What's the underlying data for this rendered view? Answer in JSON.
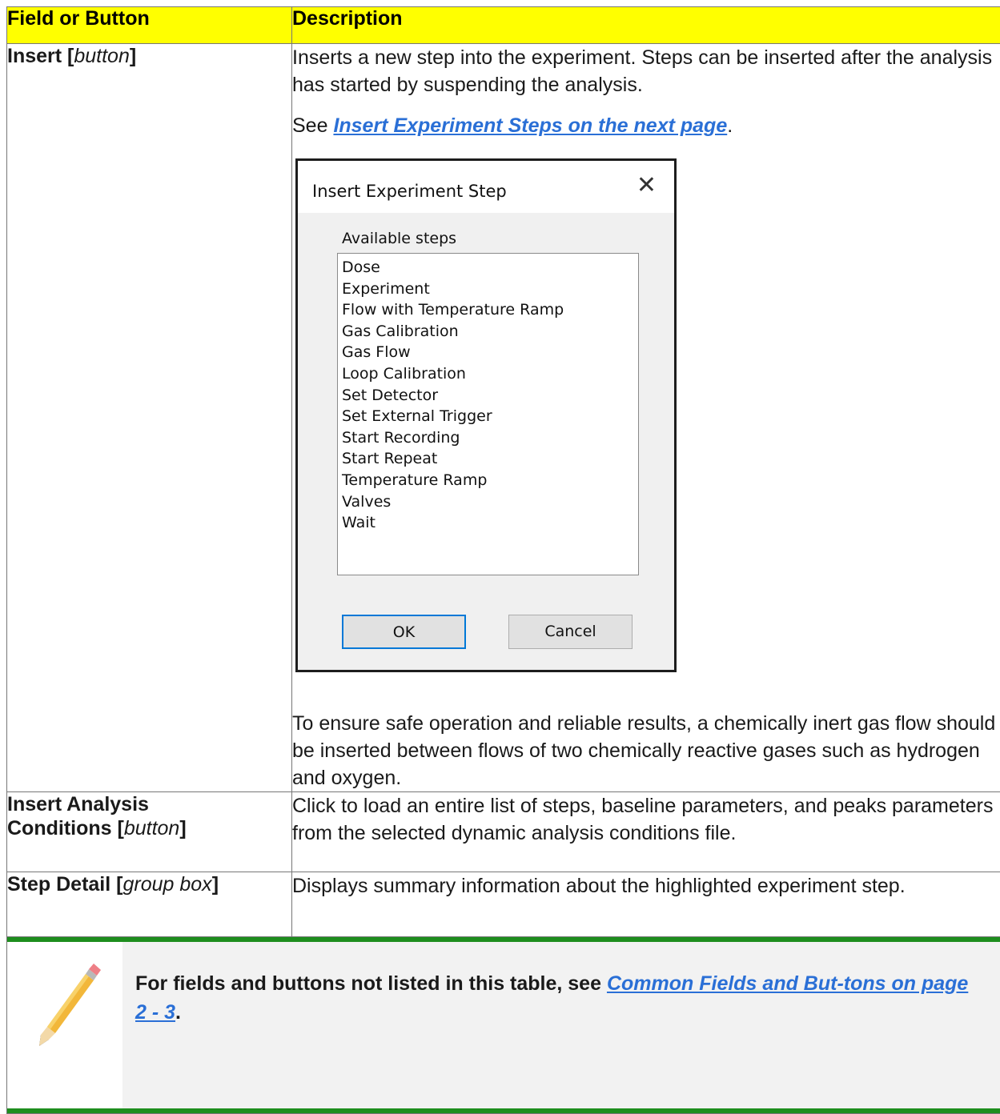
{
  "table": {
    "header_field": "Field or Button",
    "header_description": "Description",
    "rows": [
      {
        "field_name": "Insert [",
        "field_type": "button",
        "field_end": "]",
        "desc_p1": "Inserts a new step into the experiment. Steps can be inserted after the analysis has started by suspending the analysis.",
        "desc_see_prefix": "See ",
        "desc_see_link": "Insert Experiment Steps on the next page",
        "desc_see_suffix": ".",
        "desc_p3": "To ensure safe operation and reliable results, a chemically inert gas flow should be inserted between flows of two chemically reactive gases such as hydrogen and oxygen."
      },
      {
        "field_name_line1": "Insert Analysis",
        "field_name_line2": "Conditions [",
        "field_type": "button",
        "field_end": "]",
        "desc": "Click to load an entire list of steps, baseline parameters, and peaks parameters from the selected dynamic analysis conditions file."
      },
      {
        "field_name": "Step Detail [",
        "field_type": "group box",
        "field_end": "]",
        "desc": "Displays summary information about the highlighted experiment step."
      }
    ]
  },
  "dialog": {
    "title": "Insert Experiment Step",
    "close_glyph": "✕",
    "label": "Available steps",
    "steps": [
      "Dose",
      "Experiment",
      "Flow with Temperature Ramp",
      "Gas Calibration",
      "Gas Flow",
      "Loop Calibration",
      "Set Detector",
      "Set External Trigger",
      "Start Recording",
      "Start Repeat",
      "Temperature Ramp",
      "Valves",
      "Wait"
    ],
    "ok_label": "OK",
    "cancel_label": "Cancel"
  },
  "note": {
    "icon": "pencil-icon",
    "prefix": "For fields and buttons not listed in this table, see ",
    "link": "Common Fields and But-tons on page 2 - 3",
    "suffix": "."
  },
  "colors": {
    "header_bg": "#ffff00",
    "link": "#2a6fd6",
    "note_rule": "#1e8e1e"
  }
}
